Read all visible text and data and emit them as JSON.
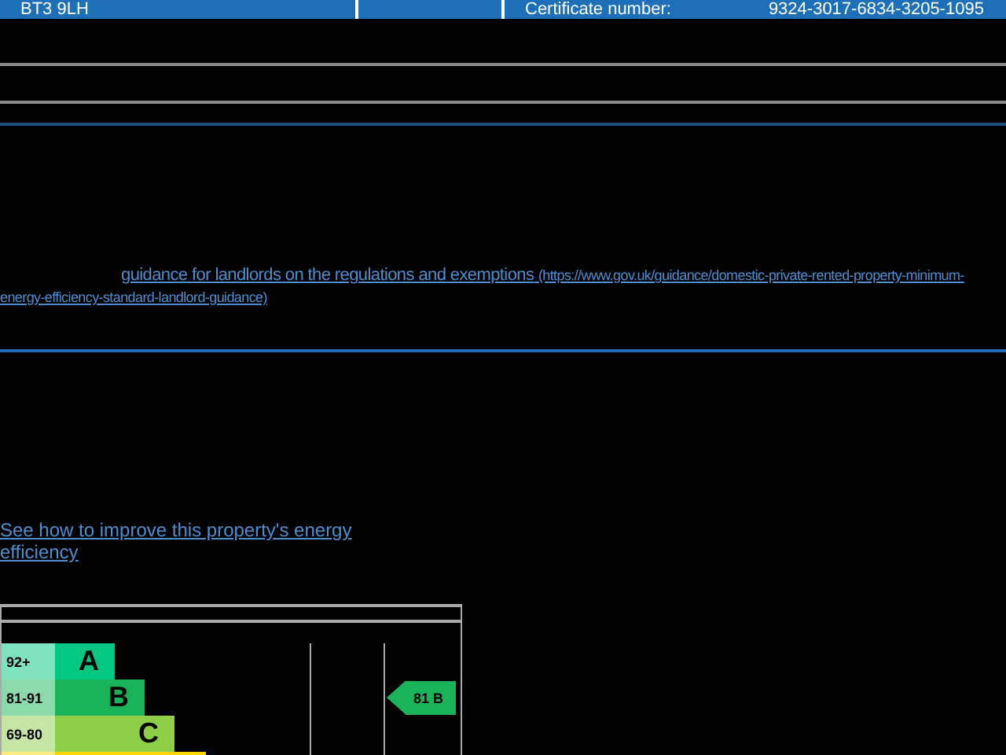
{
  "header": {
    "postcode": "BT3 9LH",
    "certificate_label": "Certificate number:",
    "certificate_number": "9324-3017-6834-3205-1095"
  },
  "guidance_link": {
    "text": "guidance for landlords on the regulations and exemptions",
    "url": "(https://www.gov.uk/guidance/domestic-private-rented-property-minimum-energy-efficiency-standard-landlord-guidance)"
  },
  "improve_link": "See how to improve this property's energy efficiency",
  "rating_table": {
    "rows": [
      {
        "score": "92+",
        "letter": "A",
        "color": "#00c781"
      },
      {
        "score": "81-91",
        "letter": "B",
        "color": "#19b459",
        "potential": "81 B"
      },
      {
        "score": "69-80",
        "letter": "C",
        "color": "#8dce46"
      },
      {
        "color": "#ffd500"
      }
    ]
  }
}
